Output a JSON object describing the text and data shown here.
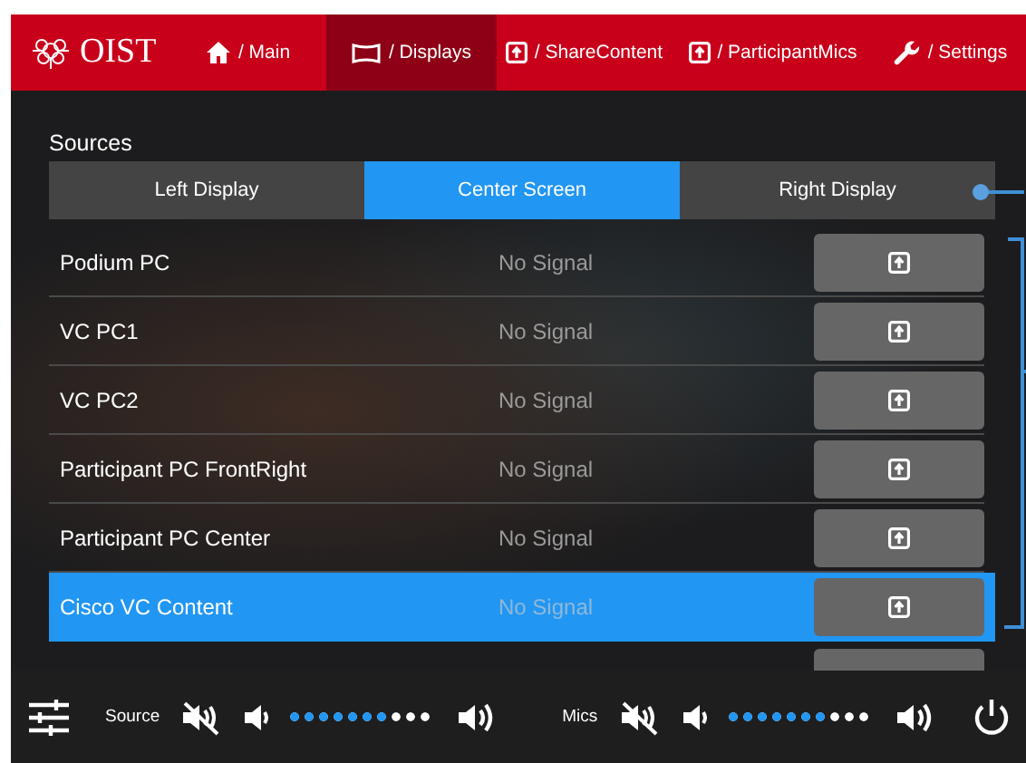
{
  "logo": {
    "text": "OIST"
  },
  "nav": [
    {
      "label": "/ Main",
      "kind": "home",
      "selected": false
    },
    {
      "label": "/ Displays",
      "kind": "display",
      "selected": true
    },
    {
      "label": "/ ShareContent",
      "kind": "share",
      "selected": false
    },
    {
      "label": "/ ParticipantMics",
      "kind": "share",
      "selected": false
    },
    {
      "label": "/ Settings",
      "kind": "wrench",
      "selected": false
    }
  ],
  "sources_title": "Sources",
  "displays": [
    {
      "label": "Left Display",
      "selected": false
    },
    {
      "label": "Center Screen",
      "selected": true
    },
    {
      "label": "Right Display",
      "selected": false
    }
  ],
  "sources": [
    {
      "name": "Podium PC",
      "status": "No Signal",
      "selected": false
    },
    {
      "name": "VC PC1",
      "status": "No Signal",
      "selected": false
    },
    {
      "name": "VC PC2",
      "status": "No Signal",
      "selected": false
    },
    {
      "name": "Participant PC FrontRight",
      "status": "No Signal",
      "selected": false
    },
    {
      "name": "Participant PC Center",
      "status": "No Signal",
      "selected": false
    },
    {
      "name": "Cisco VC Content",
      "status": "No Signal",
      "selected": true
    }
  ],
  "audio": [
    {
      "label": "Source",
      "muted": false,
      "level": 0.7
    },
    {
      "label": "Mics",
      "muted": false,
      "level": 0.7
    }
  ]
}
